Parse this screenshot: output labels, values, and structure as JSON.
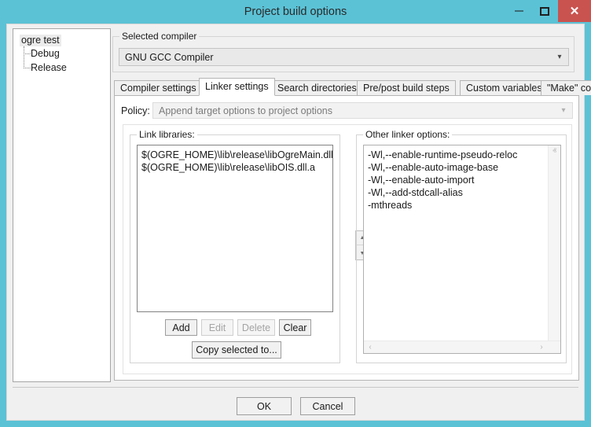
{
  "window": {
    "title": "Project build options",
    "accent_color": "#5bc2d6",
    "close_button_color": "#c9534f",
    "controls": {
      "minimize": "–",
      "maximize": "□",
      "close": "✕"
    }
  },
  "tree": {
    "root": "ogre test",
    "children": [
      "Debug",
      "Release"
    ]
  },
  "compiler_group": {
    "label": "Selected compiler",
    "selected": "GNU GCC Compiler",
    "arrow": "▾"
  },
  "tabs": [
    {
      "label": "Compiler settings",
      "active": false
    },
    {
      "label": "Linker settings",
      "active": true
    },
    {
      "label": "Search directories",
      "active": false
    },
    {
      "label": "Pre/post build steps",
      "active": false
    },
    {
      "label": "Custom variables",
      "active": false
    },
    {
      "label": "\"Make\" commands",
      "active": false
    }
  ],
  "policy": {
    "label": "Policy:",
    "value": "Append target options to project options",
    "arrow": "▾",
    "disabled": true
  },
  "link_libraries": {
    "label": "Link libraries:",
    "items": [
      "$(OGRE_HOME)\\lib\\release\\libOgreMain.dll.a",
      "$(OGRE_HOME)\\lib\\release\\libOIS.dll.a"
    ],
    "buttons": {
      "add": "Add",
      "edit": "Edit",
      "delete": "Delete",
      "clear": "Clear",
      "copy_selected": "Copy selected to..."
    }
  },
  "spinner": {
    "up": "▲",
    "down": "▼"
  },
  "other_linker_options": {
    "label": "Other linker options:",
    "lines": [
      "-Wl,--enable-runtime-pseudo-reloc",
      "-Wl,--enable-auto-image-base",
      "-Wl,--enable-auto-import",
      "-Wl,--add-stdcall-alias",
      "-mthreads"
    ],
    "scrollbars": {
      "up": "ⱏ",
      "down": "ⱟ",
      "left": "‹",
      "right": "›"
    }
  },
  "dialog_buttons": {
    "ok": "OK",
    "cancel": "Cancel"
  }
}
